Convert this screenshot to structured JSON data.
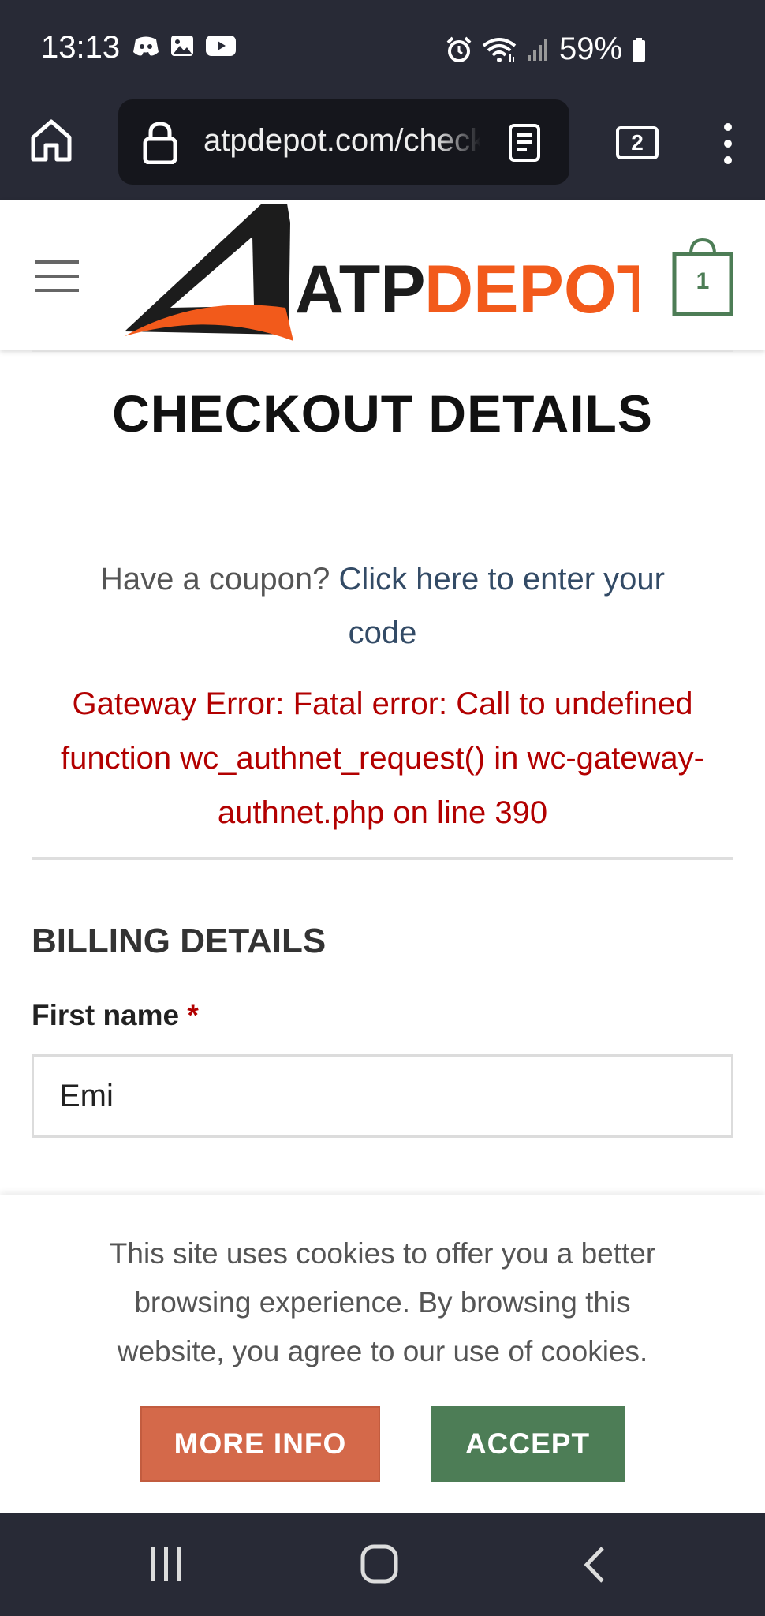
{
  "status_bar": {
    "time": "13:13",
    "battery": "59%",
    "icons_left": [
      "discord-icon",
      "gallery-icon",
      "youtube-icon"
    ],
    "icons_right": [
      "alarm-icon",
      "wifi-icon",
      "signal-icon",
      "battery-icon"
    ]
  },
  "browser": {
    "url": "atpdepot.com/checkout",
    "tab_count": "2"
  },
  "header": {
    "logo_text_dark": "ATP",
    "logo_text_accent": "DEPOT",
    "cart_count": "1",
    "brand_orange": "#f25a1b",
    "brand_green": "#4d7d56"
  },
  "main": {
    "title": "CHECKOUT DETAILS",
    "coupon_prefix": "Have a coupon?",
    "coupon_link": "Click here to enter your code",
    "error_message": "Gateway Error: Fatal error: Call to undefined function wc_authnet_request() in wc-gateway-authnet.php on line 390"
  },
  "billing": {
    "heading": "BILLING DETAILS",
    "first_name_label": "First name",
    "required_mark": "*",
    "first_name_value": "Emi"
  },
  "cookie_banner": {
    "text": "This site uses cookies to offer you a better browsing experience. By browsing this website, you agree to our use of cookies.",
    "more_info_label": "MORE INFO",
    "accept_label": "ACCEPT"
  }
}
